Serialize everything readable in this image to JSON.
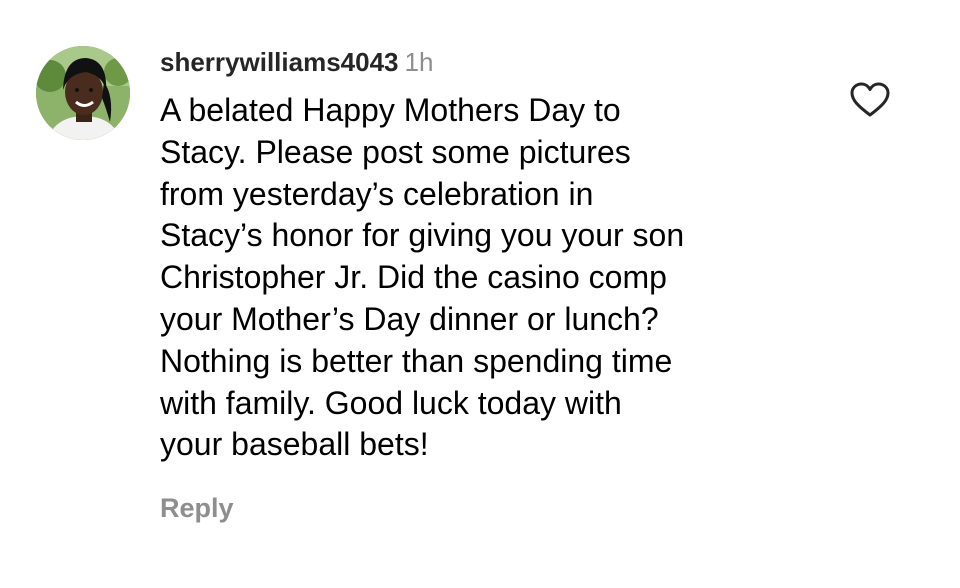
{
  "comment": {
    "username": "sherrywilliams4043",
    "time": "1h",
    "lines": [
      "A belated Happy Mothers Day to",
      "Stacy. Please post some pictures",
      "from yesterday’s celebration in",
      "Stacy’s honor for giving you your son",
      "Christopher Jr.  Did the casino comp",
      "your Mother’s Day dinner or lunch?",
      "Nothing is better than spending time",
      "with family.  Good luck today with",
      "your baseball bets!"
    ],
    "reply_label": "Reply",
    "avatar_icon": "profile-photo",
    "like_icon": "heart-outline-icon"
  },
  "colors": {
    "username": "#262626",
    "secondary_text": "#8e8e8e",
    "body_text": "#000000",
    "background": "#ffffff"
  }
}
